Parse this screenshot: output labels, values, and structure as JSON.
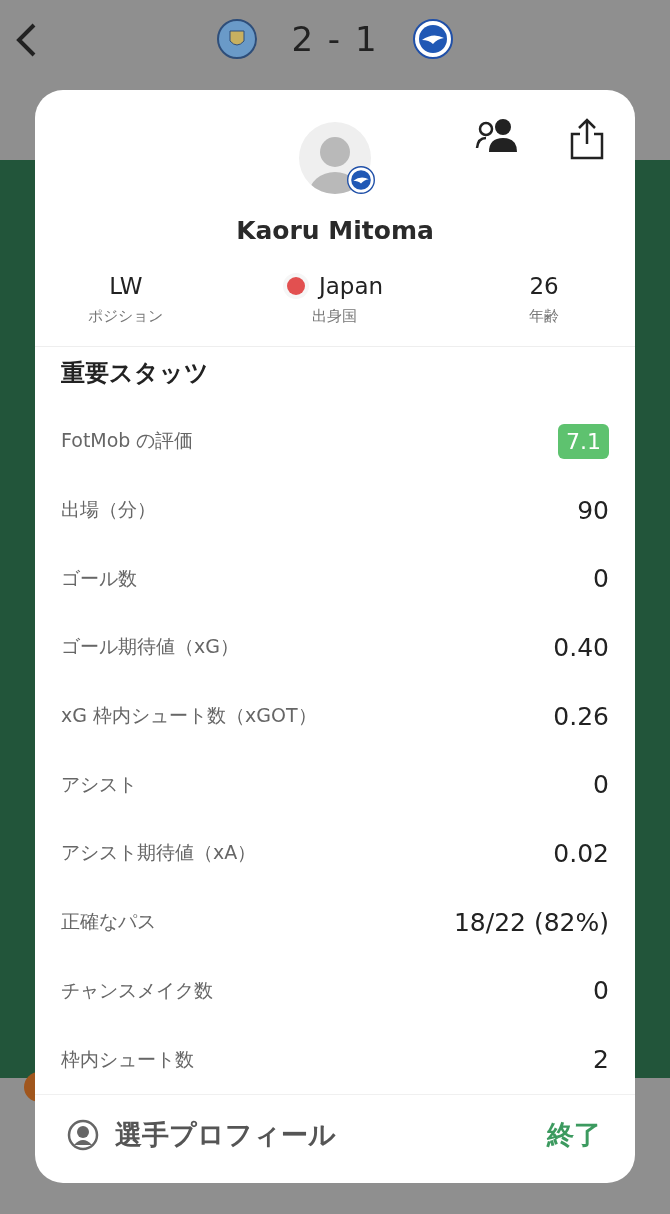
{
  "match": {
    "score": "2 - 1"
  },
  "player": {
    "name": "Kaoru Mitoma",
    "facts": [
      {
        "kind": "text",
        "value": "LW",
        "label": "ポジション"
      },
      {
        "kind": "flag",
        "value": "Japan",
        "label": "出身国"
      },
      {
        "kind": "text",
        "value": "26",
        "label": "年齢"
      }
    ]
  },
  "stats": {
    "title": "重要スタッツ",
    "rows": [
      {
        "kind": "rating",
        "label": "FotMob の評価",
        "value": "7.1"
      },
      {
        "kind": "plain",
        "label": "出場（分）",
        "value": "90"
      },
      {
        "kind": "plain",
        "label": "ゴール数",
        "value": "0"
      },
      {
        "kind": "plain",
        "label": "ゴール期待値（xG）",
        "value": "0.40"
      },
      {
        "kind": "plain",
        "label": "xG 枠内シュート数（xGOT）",
        "value": "0.26"
      },
      {
        "kind": "plain",
        "label": "アシスト",
        "value": "0"
      },
      {
        "kind": "plain",
        "label": "アシスト期待値（xA）",
        "value": "0.02"
      },
      {
        "kind": "plain",
        "label": "正確なパス",
        "value": "18/22 (82%)"
      },
      {
        "kind": "plain",
        "label": "チャンスメイク数",
        "value": "0"
      },
      {
        "kind": "plain",
        "label": "枠内シュート数",
        "value": "2"
      }
    ]
  },
  "footer": {
    "profile": "選手プロフィール",
    "close": "終了"
  }
}
